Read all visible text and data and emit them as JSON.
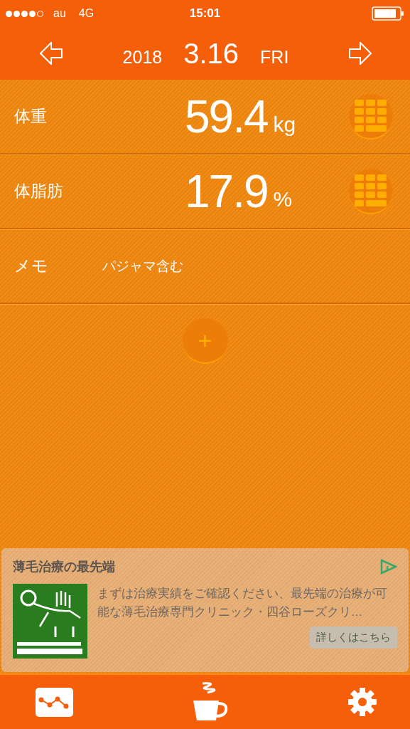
{
  "status_bar": {
    "carrier": "au",
    "network": "4G",
    "time": "15:01"
  },
  "header": {
    "year": "2018",
    "date": "3.16",
    "weekday": "FRI"
  },
  "entries": [
    {
      "kind": "measurement",
      "label": "体重",
      "value": "59.4",
      "unit": "kg"
    },
    {
      "kind": "measurement",
      "label": "体脂肪",
      "value": "17.9",
      "unit": "%"
    },
    {
      "kind": "memo",
      "label": "メモ",
      "value": "パジャマ含む"
    }
  ],
  "add_button": "+",
  "ad": {
    "title": "薄毛治療の最先端",
    "body": "まずは治療実績をご確認ください、最先端の治療が可能な薄毛治療専門クリニック・四谷ローズクリ…",
    "button": "詳しくはこちら"
  }
}
